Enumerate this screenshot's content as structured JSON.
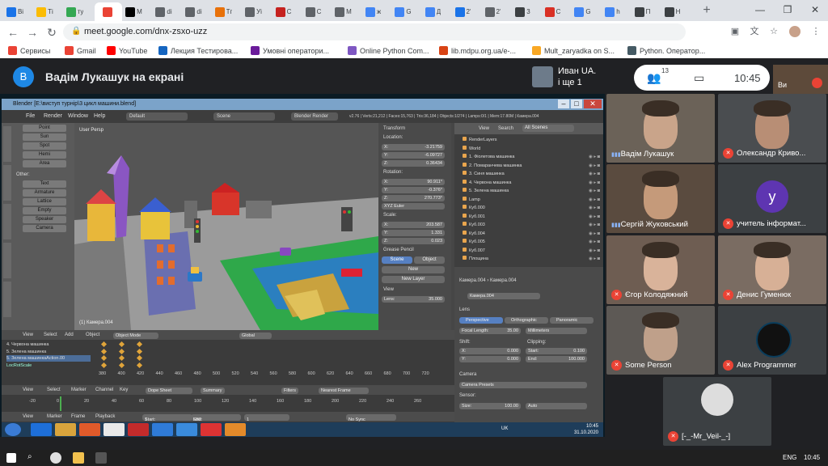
{
  "browser": {
    "tabs": [
      {
        "label": "Ві",
        "color": "#1a73e8"
      },
      {
        "label": "Ті",
        "color": "#fbbc04"
      },
      {
        "label": "ту",
        "color": "#34a853"
      },
      {
        "label": "",
        "color": "#ea4335",
        "active": true
      },
      {
        "label": "М",
        "color": "#000000"
      },
      {
        "label": "di",
        "color": "#5f6368"
      },
      {
        "label": "di",
        "color": "#5f6368"
      },
      {
        "label": "Тг",
        "color": "#e8710a"
      },
      {
        "label": "Уі",
        "color": "#5f6368"
      },
      {
        "label": "С",
        "color": "#c5221f"
      },
      {
        "label": "С",
        "color": "#5f6368"
      },
      {
        "label": "М",
        "color": "#5f6368"
      },
      {
        "label": "ж",
        "color": "#4285f4"
      },
      {
        "label": "G",
        "color": "#4285f4"
      },
      {
        "label": "Д",
        "color": "#4285f4"
      },
      {
        "label": "2'",
        "color": "#1a73e8"
      },
      {
        "label": "2'",
        "color": "#5f6368"
      },
      {
        "label": "3",
        "color": "#3c4043"
      },
      {
        "label": "С",
        "color": "#d93025"
      },
      {
        "label": "G",
        "color": "#4285f4"
      },
      {
        "label": "h",
        "color": "#4285f4"
      },
      {
        "label": "П",
        "color": "#3c4043"
      },
      {
        "label": "Н",
        "color": "#3c4043"
      }
    ],
    "new_tab": "+",
    "url": "meet.google.com/dnx-zsxo-uzz",
    "bookmarks": [
      {
        "label": "Сервисы",
        "color": "#ea4335"
      },
      {
        "label": "Gmail",
        "color": "#ea4335"
      },
      {
        "label": "YouTube",
        "color": "#ff0000"
      },
      {
        "label": "Лекция Тестирова...",
        "color": "#1565c0"
      },
      {
        "label": "Умовні оператори...",
        "color": "#6a1b9a"
      },
      {
        "label": "Online Python Com...",
        "color": "#7e57c2"
      },
      {
        "label": "lib.mdpu.org.ua/e-...",
        "color": "#d84315"
      },
      {
        "label": "Mult_zaryadka on S...",
        "color": "#f9a825"
      },
      {
        "label": "Python. Оператор...",
        "color": "#455a64"
      }
    ]
  },
  "meet": {
    "presenter_initial": "В",
    "presenter_title": "Вадім Лукашук на екрані",
    "other_presenter": {
      "line1": "Иван UA.",
      "line2": "і ще 1"
    },
    "participants_count": "13",
    "time": "10:45",
    "corner_label": "Ви",
    "participants": [
      {
        "name": "Вадім Лукашук",
        "muted": false
      },
      {
        "name": "Олександр Криво...",
        "muted": true
      },
      {
        "name": "Сергій Жуковський",
        "muted": false
      },
      {
        "name": "учитель інформат...",
        "muted": true,
        "avatar": "у",
        "avatar_color": "#5e35b1"
      },
      {
        "name": "Єгор Колодяжний",
        "muted": true
      },
      {
        "name": "Денис Гуменюк",
        "muted": true
      },
      {
        "name": "Some Person",
        "muted": true
      },
      {
        "name": "Alex Programmer",
        "muted": true
      },
      {
        "name": "[-_-Mr_Veil-_-]",
        "muted": true
      }
    ]
  },
  "blender": {
    "title": "Blender [E:\\виступ турнір\\3 цикл машини.blend]",
    "menu": [
      "File",
      "Render",
      "Window",
      "Help"
    ],
    "layout": "Default",
    "scene": "Scene",
    "engine": "Blender Render",
    "stats": "v2.76 | Verts:21,212 | Faces:15,763 | Tris:36,184 | Objects:1/274 | Lamps:0/1 | Mem:17.80M | Камера.004",
    "viewport_label": "User Persp",
    "camera_label": "(1) Камера.004",
    "toolshelf": {
      "lamps": [
        "Point",
        "Sun",
        "Spot",
        "Hemi",
        "Area"
      ],
      "other_title": "Other:",
      "other": [
        "Text",
        "Armature",
        "Lattice",
        "Empty",
        "Speaker",
        "Camera"
      ],
      "vtabs": [
        "Create",
        "Relations",
        "Animation",
        "Physics",
        "Grease Pencil"
      ]
    },
    "transform": {
      "title": "Transform",
      "location_label": "Location:",
      "location": [
        [
          "X:",
          "-3.21759"
        ],
        [
          "Y:",
          "-6.09727"
        ],
        [
          "Z:",
          "0.36434"
        ]
      ],
      "rotation_label": "Rotation:",
      "rotation": [
        [
          "X:",
          "90.911°"
        ],
        [
          "Y:",
          "-0.376°"
        ],
        [
          "Z:",
          "270.773°"
        ]
      ],
      "rot_mode": "XYZ Euler",
      "scale_label": "Scale:",
      "scale": [
        [
          "X:",
          "203.587"
        ],
        [
          "Y:",
          "1.331"
        ],
        [
          "Z:",
          "0.023"
        ]
      ],
      "grease_title": "Grease Pencil",
      "grease_tabs": [
        "Scene",
        "Object"
      ],
      "grease_new": "New",
      "grease_new_layer": "New Layer",
      "view_title": "View",
      "lens": "Lens:",
      "lens_value": "35.000"
    },
    "outliner": {
      "header": [
        "View",
        "Search",
        "All Scenes"
      ],
      "items": [
        "RenderLayers",
        "World",
        "1. Фіолетова машинка",
        "2. Помаранчева машинка",
        "3. Синя машинка",
        "4. Червона машинка",
        "5. Зелена машинка",
        "Lamp",
        "Куб.000",
        "Куб.001",
        "Куб.003",
        "Куб.004",
        "Куб.005",
        "Куб.007",
        "Площина"
      ]
    },
    "camera_props": {
      "breadcrumb": [
        "Камера.004",
        "Камера.004"
      ],
      "name": "Камера.004",
      "lens_title": "Lens",
      "lens_types": [
        "Perspective",
        "Orthographic",
        "Panoramic"
      ],
      "focal_label": "Focal Length:",
      "focal_value": "35.00",
      "focal_unit": "Millimeters",
      "shift_label": "Shift:",
      "shift": [
        [
          "X:",
          "0.000"
        ],
        [
          "Y:",
          "0.000"
        ]
      ],
      "clipping_label": "Clipping:",
      "clipping": [
        [
          "Start:",
          "0.100"
        ],
        [
          "End:",
          "100.000"
        ]
      ],
      "camera_title": "Camera",
      "presets": "Camera Presets",
      "sensor_label": "Sensor:",
      "size_label": "Size:",
      "size_value": "100.00",
      "sensor_fit": "Auto"
    },
    "dopesheet": {
      "rows": [
        "4. Червона машинка",
        "5. Зелена машинка",
        "5. Зелена машинкаAction.00",
        "LocRotScale"
      ],
      "ticks": [
        "380",
        "400",
        "420",
        "440",
        "460",
        "480",
        "500",
        "520",
        "540",
        "560",
        "580",
        "600",
        "620",
        "640",
        "660",
        "680",
        "700",
        "720"
      ],
      "header": [
        "View",
        "Select",
        "Marker",
        "Channel",
        "Key"
      ],
      "mode": "Dope Sheet",
      "summary": "Summary",
      "filters": "Filters",
      "nearest": "Nearest Frame"
    },
    "viewport_header": [
      "View",
      "Select",
      "Add",
      "Object"
    ],
    "object_mode": "Object Mode",
    "global": "Global",
    "timeline": {
      "ticks": [
        "-20",
        "0",
        "20",
        "40",
        "60",
        "80",
        "100",
        "120",
        "140",
        "160",
        "180",
        "200",
        "220",
        "240",
        "260"
      ],
      "header": [
        "View",
        "Marker",
        "Frame",
        "Playback"
      ],
      "start_label": "Start:",
      "start": "1",
      "end_label": "End:",
      "end": "580",
      "current": "1",
      "sync": "No Sync"
    }
  },
  "shared_taskbar": {
    "lang": "UK",
    "time": "10:45",
    "date": "31.10.2020"
  },
  "bottom_taskbar": {
    "lang": "ENG",
    "time": "10:45"
  }
}
